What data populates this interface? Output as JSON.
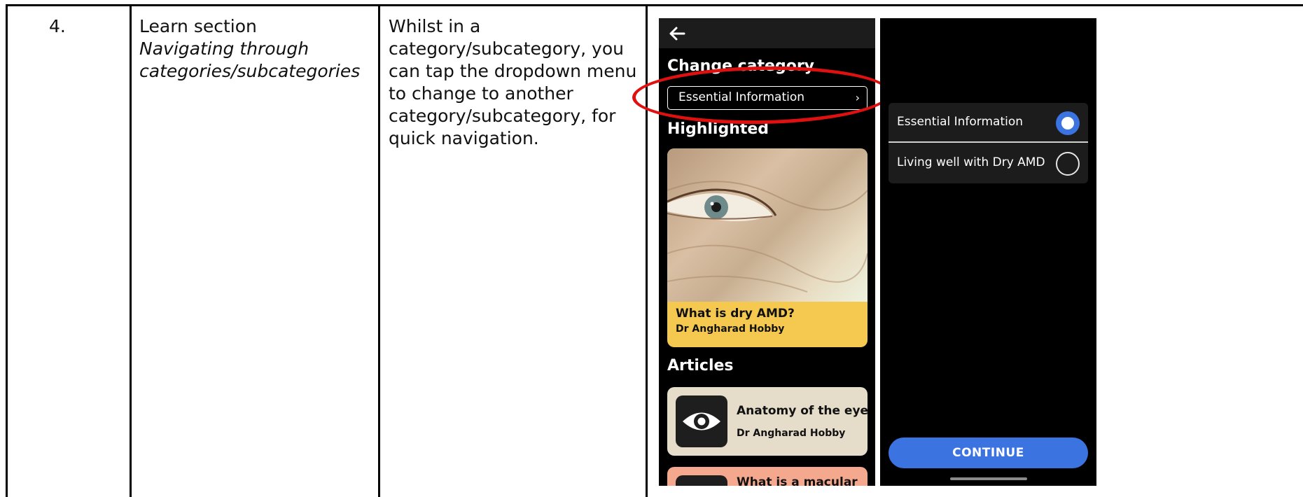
{
  "table": {
    "row_number": "4.",
    "section_title": "Learn section",
    "section_subtitle": "Navigating through categories/subcategories",
    "description": "Whilst in a category/subcategory, you can tap the dropdown menu to change to another category/subcategory, for quick navigation."
  },
  "screen1": {
    "change_category_heading": "Change category",
    "dropdown_value": "Essential Information",
    "dropdown_chevron": "›",
    "highlighted_heading": "Highlighted",
    "highlight_card": {
      "title": "What is dry AMD?",
      "author": "Dr Angharad Hobby"
    },
    "articles_heading": "Articles",
    "articles": [
      {
        "title": "Anatomy of the eye",
        "author": "Dr Angharad Hobby",
        "icon": "eye-icon"
      },
      {
        "title": "What is a macular",
        "icon": "article-thumbnail"
      }
    ],
    "annotation_color": "#e01010"
  },
  "screen2": {
    "options": [
      {
        "label": "Essential Information",
        "selected": true
      },
      {
        "label": "Living well with Dry AMD",
        "selected": false
      }
    ],
    "continue_label": "CONTINUE",
    "accent_color": "#3b73e0"
  }
}
